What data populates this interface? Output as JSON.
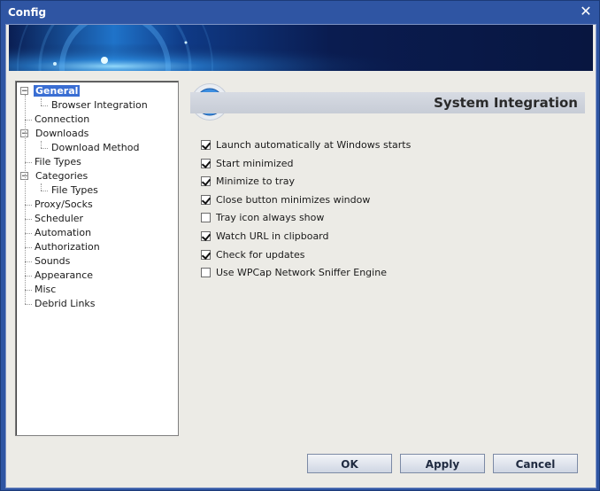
{
  "window": {
    "title": "Config",
    "close_icon": "close-icon"
  },
  "tree": {
    "items": [
      {
        "label": "General",
        "level": 0,
        "selected": true,
        "expander": "−"
      },
      {
        "label": "Browser Integration",
        "level": 2
      },
      {
        "label": "Connection",
        "level": 1
      },
      {
        "label": "Downloads",
        "level": 0,
        "expander": "−"
      },
      {
        "label": "Download Method",
        "level": 2
      },
      {
        "label": "File Types",
        "level": 1
      },
      {
        "label": "Categories",
        "level": 0,
        "expander": "−"
      },
      {
        "label": "File Types",
        "level": 2
      },
      {
        "label": "Proxy/Socks",
        "level": 1
      },
      {
        "label": "Scheduler",
        "level": 1
      },
      {
        "label": "Automation",
        "level": 1
      },
      {
        "label": "Authorization",
        "level": 1
      },
      {
        "label": "Sounds",
        "level": 1
      },
      {
        "label": "Appearance",
        "level": 1
      },
      {
        "label": "Misc",
        "level": 1
      },
      {
        "label": "Debrid Links",
        "level": 1
      }
    ]
  },
  "panel": {
    "title": "System Integration",
    "options": [
      {
        "label": "Launch automatically at Windows starts",
        "checked": true
      },
      {
        "label": "Start minimized",
        "checked": true
      },
      {
        "label": "Minimize to tray",
        "checked": true
      },
      {
        "label": "Close button minimizes window",
        "checked": true
      },
      {
        "label": "Tray icon always show",
        "checked": false
      },
      {
        "label": "Watch URL in clipboard",
        "checked": true
      },
      {
        "label": "Check for updates",
        "checked": true
      },
      {
        "label": "Use WPCap Network Sniffer Engine",
        "checked": false
      }
    ]
  },
  "buttons": {
    "ok": "OK",
    "apply": "Apply",
    "cancel": "Cancel"
  },
  "colors": {
    "titlebar": "#2f55a3",
    "selection": "#3a6ed3",
    "client": "#ecebe6"
  }
}
